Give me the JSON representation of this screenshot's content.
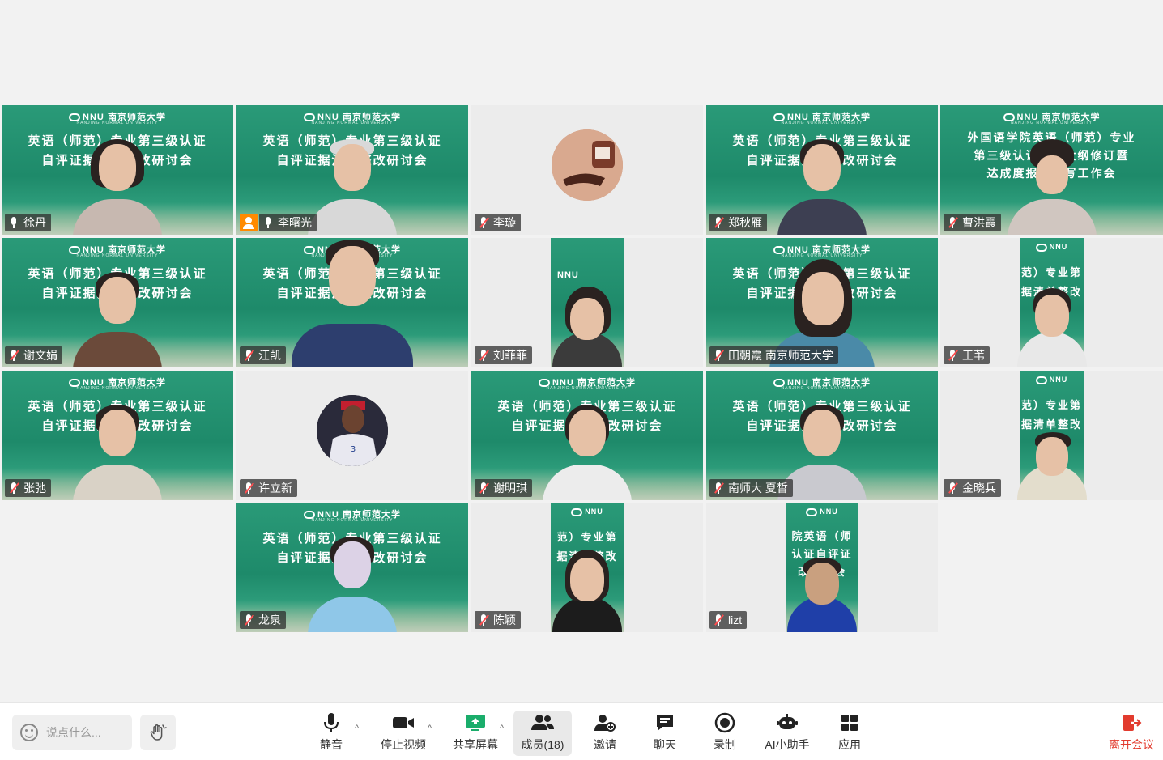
{
  "slide": {
    "logo": "NNU",
    "logo_cn": "南京师范大学",
    "logo_en": "NANJING NORMAL UNIVERSITY",
    "title_line1": "英语（师范）专业第三级认证",
    "title_line2": "自评证据清单整改研讨会",
    "alt_line1": "外国语学院英语（师范）专业",
    "alt_line2": "第三级认证课程大纲修订暨",
    "alt_line3": "达成度报告撰写工作会"
  },
  "participants": [
    {
      "name": "徐丹",
      "muted": false
    },
    {
      "name": "李曙光",
      "muted": false,
      "host": true
    },
    {
      "name": "李璇",
      "muted": true
    },
    {
      "name": "郑秋雁",
      "muted": true
    },
    {
      "name": "曹洪霞",
      "muted": true
    },
    {
      "name": "谢文娟",
      "muted": true
    },
    {
      "name": "汪凯",
      "muted": true
    },
    {
      "name": "刘菲菲",
      "muted": true
    },
    {
      "name": "田朝霞 南京师范大学",
      "muted": true
    },
    {
      "name": "王苇",
      "muted": true
    },
    {
      "name": "张弛",
      "muted": true
    },
    {
      "name": "许立新",
      "muted": true
    },
    {
      "name": "谢明琪",
      "muted": true
    },
    {
      "name": "南师大 夏皙",
      "muted": true
    },
    {
      "name": "金晓兵",
      "muted": true
    },
    {
      "name": "龙泉",
      "muted": true
    },
    {
      "name": "陈颖",
      "muted": true
    },
    {
      "name": "lizt",
      "muted": true
    }
  ],
  "toolbar": {
    "chat_placeholder": "说点什么...",
    "mute": "静音",
    "stop_video": "停止视频",
    "share_screen": "共享屏幕",
    "members": "成员(18)",
    "invite": "邀请",
    "chat": "聊天",
    "record": "录制",
    "ai_assistant": "AI小助手",
    "apps": "应用",
    "leave": "离开会议"
  },
  "colors": {
    "slide_green": "#1e8a6a",
    "active_border": "#3fbf7f",
    "leave_red": "#e23b2e",
    "host_orange": "#ff8a00"
  }
}
